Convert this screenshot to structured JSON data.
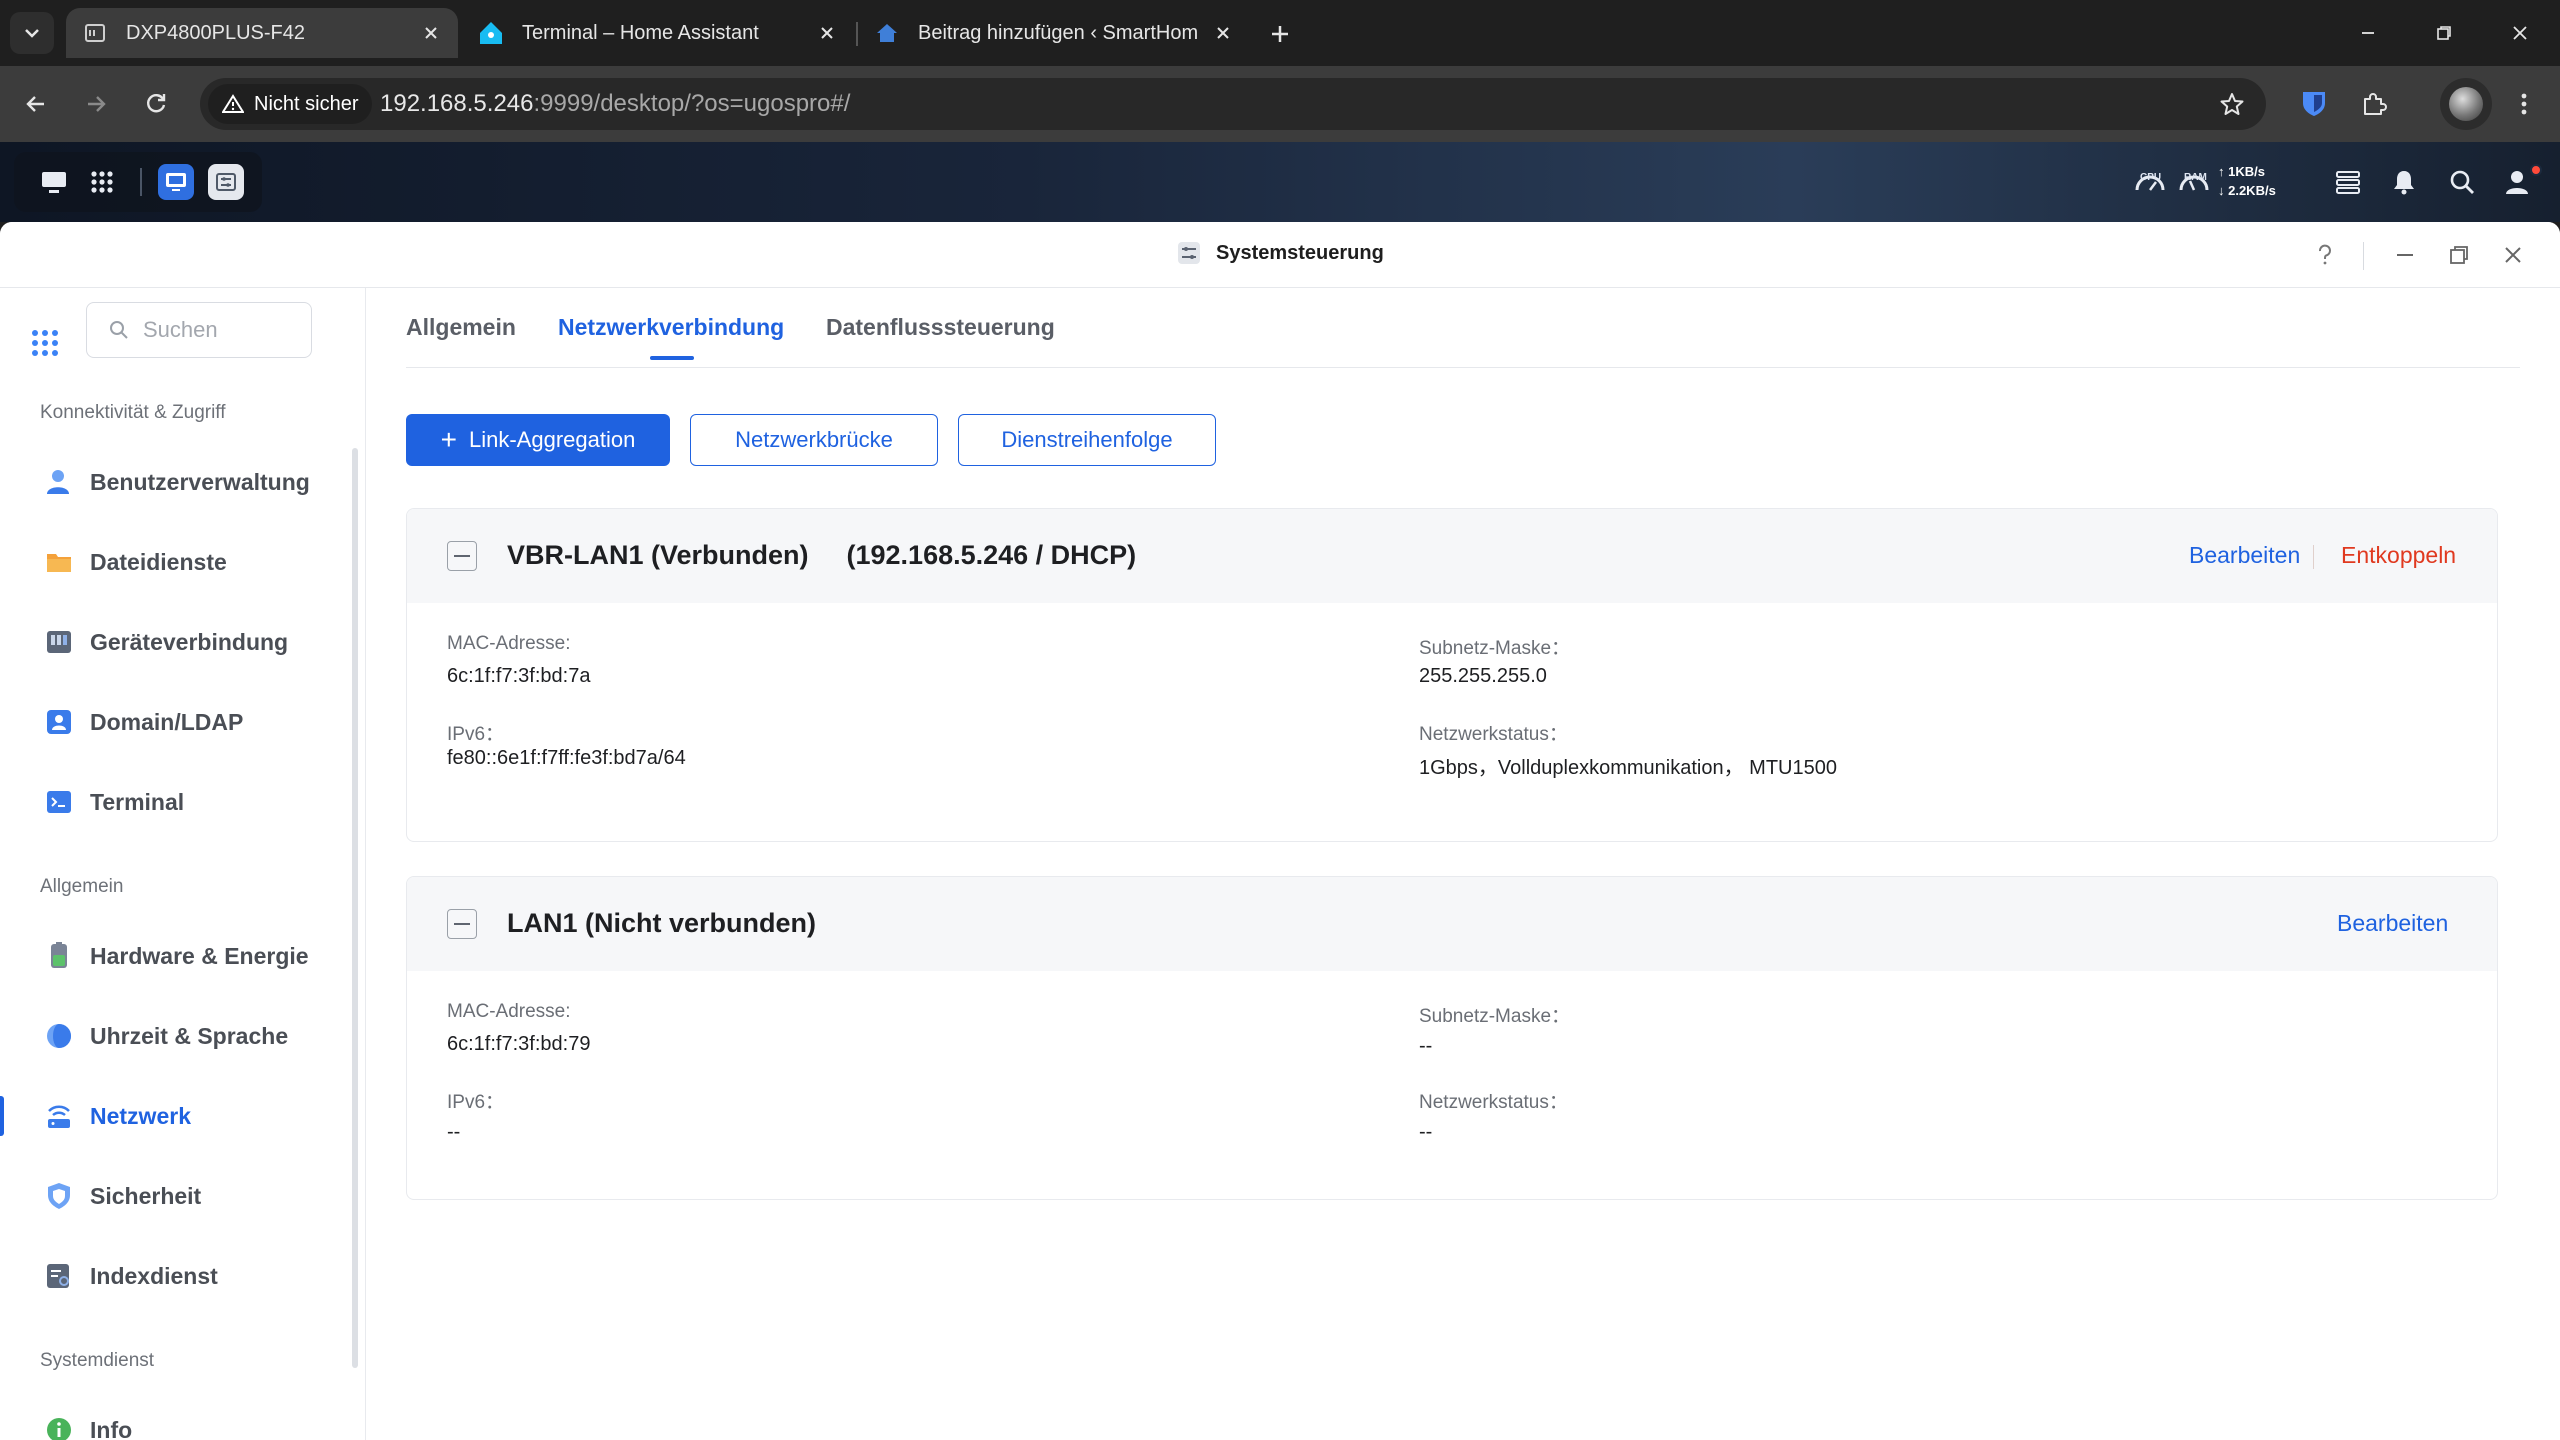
{
  "browser": {
    "tabs": [
      {
        "title": "DXP4800PLUS-F42",
        "active": true
      },
      {
        "title": "Terminal – Home Assistant",
        "active": false
      },
      {
        "title": "Beitrag hinzufügen ‹ SmartHom",
        "active": false
      }
    ],
    "security_label": "Nicht sicher",
    "url_host": "192.168.5.246",
    "url_rest": ":9999/desktop/?os=ugospro#/"
  },
  "desktop_bar": {
    "cpu_label": "CPU",
    "ram_label": "RAM",
    "upload": "↑ 1KB/s",
    "download": "↓ 2.2KB/s"
  },
  "window": {
    "title": "Systemsteuerung"
  },
  "sidebar": {
    "search_placeholder": "Suchen",
    "groups": [
      {
        "label": "Konnektivität & Zugriff"
      },
      {
        "label": "Allgemein"
      },
      {
        "label": "Systemdienst"
      }
    ],
    "items": [
      {
        "label": "Benutzerverwaltung",
        "icon": "users-icon"
      },
      {
        "label": "Dateidienste",
        "icon": "folder-icon"
      },
      {
        "label": "Geräteverbindung",
        "icon": "device-icon"
      },
      {
        "label": "Domain/LDAP",
        "icon": "domain-icon"
      },
      {
        "label": "Terminal",
        "icon": "terminal-icon"
      },
      {
        "label": "Hardware & Energie",
        "icon": "hardware-icon"
      },
      {
        "label": "Uhrzeit & Sprache",
        "icon": "globe-icon"
      },
      {
        "label": "Netzwerk",
        "icon": "network-icon",
        "active": true
      },
      {
        "label": "Sicherheit",
        "icon": "shield-icon"
      },
      {
        "label": "Indexdienst",
        "icon": "index-icon"
      },
      {
        "label": "Info",
        "icon": "info-icon"
      }
    ]
  },
  "main": {
    "tabs": [
      {
        "label": "Allgemein"
      },
      {
        "label": "Netzwerkverbindung",
        "active": true
      },
      {
        "label": "Datenflusssteuerung"
      }
    ],
    "buttons": {
      "link_aggregation": "Link-Aggregation",
      "bridge": "Netzwerkbrücke",
      "service_order": "Dienstreihenfolge"
    },
    "cards": [
      {
        "name": "VBR-LAN1 (Verbunden)",
        "ip": "(192.168.5.246 / DHCP)",
        "edit": "Bearbeiten",
        "disconnect": "Entkoppeln",
        "mac_label": "MAC-Adresse:",
        "mac": "6c:1f:f7:3f:bd:7a",
        "ipv6_label": "IPv6：",
        "ipv6": "fe80::6e1f:f7ff:fe3f:bd7a/64",
        "subnet_label": "Subnetz-Maske：",
        "subnet": "255.255.255.0",
        "status_label": "Netzwerkstatus：",
        "status": "1Gbps，Vollduplexkommunikation， MTU1500"
      },
      {
        "name": "LAN1 (Nicht verbunden)",
        "edit": "Bearbeiten",
        "mac_label": "MAC-Adresse:",
        "mac": "6c:1f:f7:3f:bd:79",
        "ipv6_label": "IPv6：",
        "ipv6": "--",
        "subnet_label": "Subnetz-Maske：",
        "subnet": "--",
        "status_label": "Netzwerkstatus：",
        "status": "--"
      }
    ]
  },
  "colors": {
    "accent": "#1f62e0",
    "danger": "#e0391f"
  }
}
